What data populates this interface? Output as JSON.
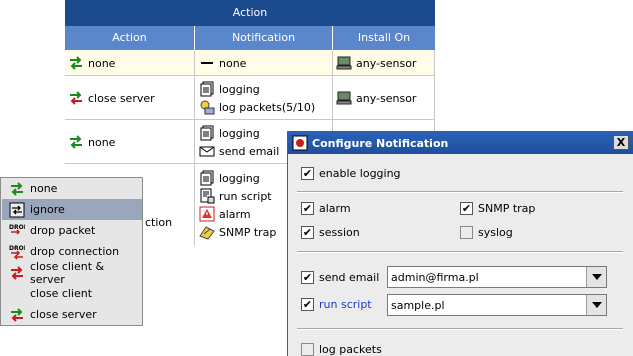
{
  "table": {
    "title": "Action",
    "columns": [
      "Action",
      "Notification",
      "Install On"
    ],
    "rows": [
      {
        "action": "none",
        "notifications": [
          "none"
        ],
        "install_on": "any-sensor"
      },
      {
        "action": "close server",
        "notifications": [
          "logging",
          "log packets(5/10)"
        ],
        "install_on": "any-sensor"
      },
      {
        "action": "none",
        "notifications": [
          "logging",
          "send email"
        ],
        "install_on": ""
      },
      {
        "action": "ction",
        "notifications": [
          "logging",
          "run script",
          "alarm",
          "SNMP trap"
        ],
        "install_on": ""
      }
    ]
  },
  "menu": {
    "items": [
      "none",
      "ignore",
      "drop packet",
      "drop connection",
      "close client & server",
      "close client",
      "close server"
    ],
    "selected": "ignore"
  },
  "dialog": {
    "title": "Configure Notification",
    "close_glyph": "X",
    "enable_logging": {
      "label": "enable logging",
      "checked": true
    },
    "alarm": {
      "label": "alarm",
      "checked": true
    },
    "snmp_trap": {
      "label": "SNMP trap",
      "checked": true
    },
    "session": {
      "label": "session",
      "checked": true
    },
    "syslog": {
      "label": "syslog",
      "checked": false
    },
    "send_email": {
      "label": "send email",
      "checked": true,
      "value": "admin@firma.pl"
    },
    "run_script": {
      "label": "run script",
      "checked": true,
      "value": "sample.pl"
    },
    "log_packets": {
      "label": "log packets",
      "checked": false
    },
    "check_glyph": "✔"
  },
  "colors": {
    "title_bar": "#1c4a8f",
    "column_header": "#5a86cc",
    "menu_selection": "#9aa6bb",
    "link_blue": "#1a3cc8"
  }
}
